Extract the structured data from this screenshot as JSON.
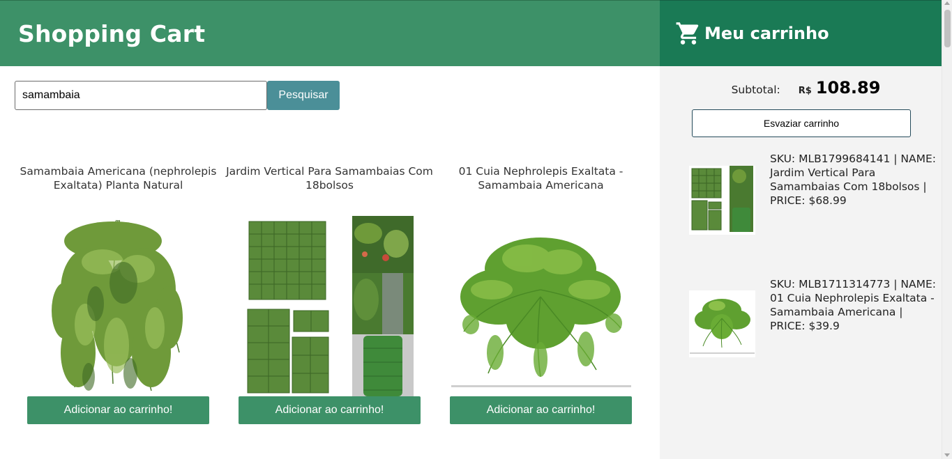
{
  "header": {
    "title": "Shopping Cart"
  },
  "search": {
    "value": "samambaia",
    "button_label": "Pesquisar"
  },
  "products": [
    {
      "title": "Samambaia Americana (nephrolepis Exaltata) Planta Natural",
      "button_label": "Adicionar ao carrinho!"
    },
    {
      "title": "Jardim Vertical Para Samambaias Com 18bolsos",
      "button_label": "Adicionar ao carrinho!"
    },
    {
      "title": "01 Cuia Nephrolepis Exaltata - Samambaia Americana",
      "button_label": "Adicionar ao carrinho!"
    }
  ],
  "cart": {
    "title": "Meu carrinho",
    "subtotal_label": "Subtotal:",
    "currency": "R$",
    "subtotal_value": "108.89",
    "empty_button_label": "Esvaziar carrinho",
    "items": [
      {
        "text": "SKU: MLB1799684141 | NAME: Jardim Vertical Para Samambaias Com 18bolsos | PRICE: $68.99"
      },
      {
        "text": "SKU: MLB1711314773 | NAME: 01 Cuia Nephrolepis Exaltata - Samambaia Americana | PRICE: $39.9"
      }
    ]
  },
  "colors": {
    "header_left": "#3d9168",
    "header_right": "#1a7a55",
    "search_button": "#4b8f98",
    "add_button": "#3d9168",
    "sidebar_bg": "#f3f3f3"
  },
  "icons": {
    "cart": "shopping-cart-icon"
  }
}
